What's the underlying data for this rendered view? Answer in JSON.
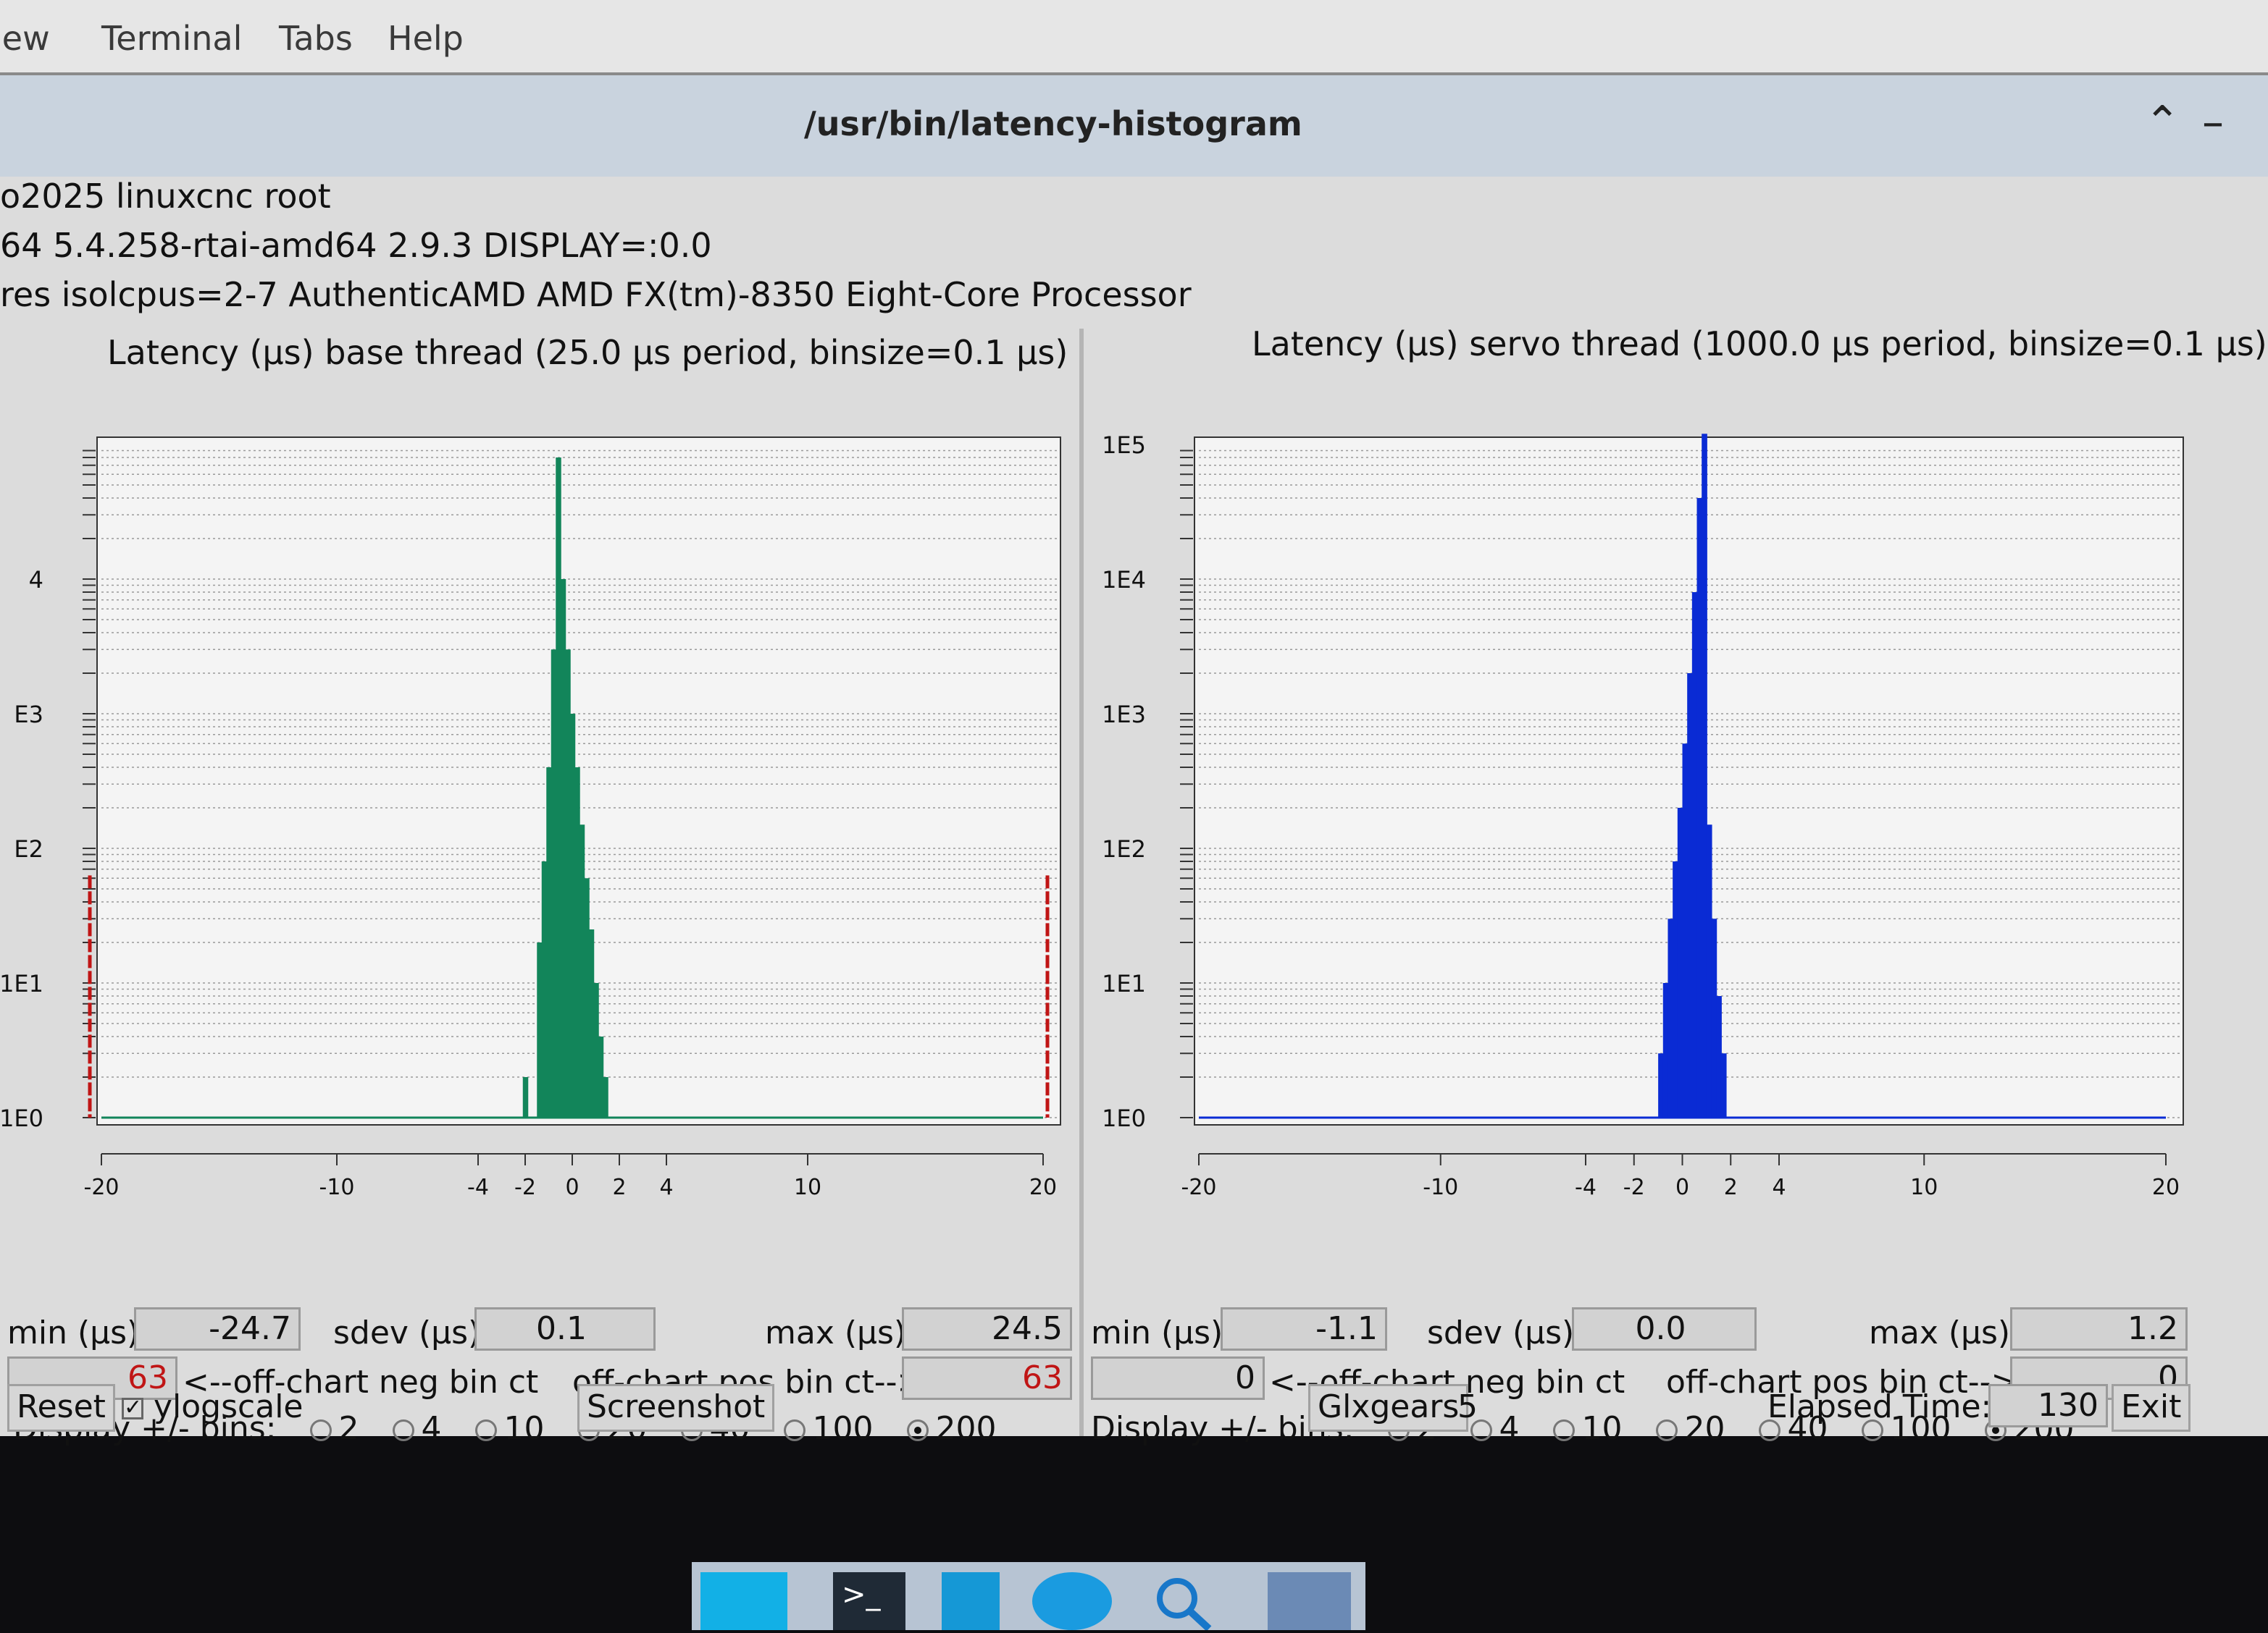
{
  "menubar": {
    "items": [
      "iew",
      "Terminal",
      "Tabs",
      "Help"
    ]
  },
  "window": {
    "title": "/usr/bin/latency-histogram",
    "info_lines": [
      "o2025 linuxcnc root",
      "64  5.4.258-rtai-amd64  2.9.3  DISPLAY=:0.0",
      "res  isolcpus=2-7  AuthenticAMD  AMD FX(tm)-8350 Eight-Core Processor"
    ]
  },
  "labels": {
    "min": "min (µs)",
    "sdev": "sdev (µs)",
    "max": "max (µs)",
    "neg_bin": "<--off-chart neg bin ct",
    "pos_bin": "off-chart pos bin ct-->",
    "display_bins": "Display +/- bins:"
  },
  "radio_options": [
    "2",
    "4",
    "10",
    "20",
    "40",
    "100",
    "200"
  ],
  "base": {
    "title": "Latency (µs) base thread (25.0 µs period, binsize=0.1 µs)",
    "min": "-24.7",
    "sdev": "0.1",
    "max": "24.5",
    "neg_count": "63",
    "pos_count": "63",
    "selected_bins": "200"
  },
  "servo": {
    "title": "Latency (µs) servo thread (1000.0 µs period, binsize=0.1 µs)",
    "min": "-1.1",
    "sdev": "0.0",
    "max": "1.2",
    "neg_count": "0",
    "pos_count": "0",
    "selected_bins": "200"
  },
  "bottom": {
    "reset": "Reset",
    "ylogscale": "ylogscale",
    "ylogscale_checked": true,
    "screenshot": "Screenshot",
    "glxgears": "Glxgears",
    "glxgears_value": "5",
    "elapsed_label": "Elapsed Time:",
    "elapsed_value": "130",
    "exit": "Exit"
  },
  "chart_data": [
    {
      "type": "bar",
      "title": "Latency (µs) base thread (25.0 µs period, binsize=0.1 µs)",
      "xlim": [
        -20,
        20
      ],
      "ylim_log10": [
        0,
        5
      ],
      "yscale": "log",
      "x_ticks": [
        -20,
        -10,
        -4,
        -2,
        0,
        2,
        4,
        10,
        20
      ],
      "y_ticks": [
        "1E0",
        "1E1",
        "E2",
        "E3",
        "4"
      ],
      "color": "#12855a",
      "x": [
        -2.0,
        -1.4,
        -1.2,
        -1.0,
        -0.8,
        -0.6,
        -0.4,
        -0.2,
        0.0,
        0.2,
        0.4,
        0.6,
        0.8,
        1.0,
        1.2,
        1.4
      ],
      "values": [
        2,
        20,
        80,
        400,
        3000,
        80000,
        10000,
        3000,
        1000,
        400,
        150,
        60,
        25,
        10,
        4,
        2
      ],
      "edge_markers": {
        "color": "#c01515",
        "neg_count": 63,
        "pos_count": 63
      }
    },
    {
      "type": "bar",
      "title": "Latency (µs) servo thread (1000.0 µs period, binsize=0.1 µs)",
      "xlim": [
        -20,
        20
      ],
      "ylim_log10": [
        0,
        5
      ],
      "yscale": "log",
      "x_ticks": [
        -20,
        -10,
        -4,
        -2,
        0,
        2,
        4,
        10,
        20
      ],
      "y_ticks": [
        "1E0",
        "1E1",
        "1E2",
        "1E3",
        "1E4",
        "1E5"
      ],
      "color": "#0a2bd4",
      "x": [
        -1.1,
        -0.9,
        -0.7,
        -0.5,
        -0.3,
        -0.1,
        0.1,
        0.3,
        0.5,
        0.7,
        0.9,
        1.1,
        1.3,
        1.5,
        1.7,
        1.9
      ],
      "values": [
        1,
        3,
        10,
        30,
        80,
        200,
        600,
        2000,
        8000,
        40000,
        120000,
        150,
        30,
        8,
        3,
        1
      ]
    }
  ]
}
